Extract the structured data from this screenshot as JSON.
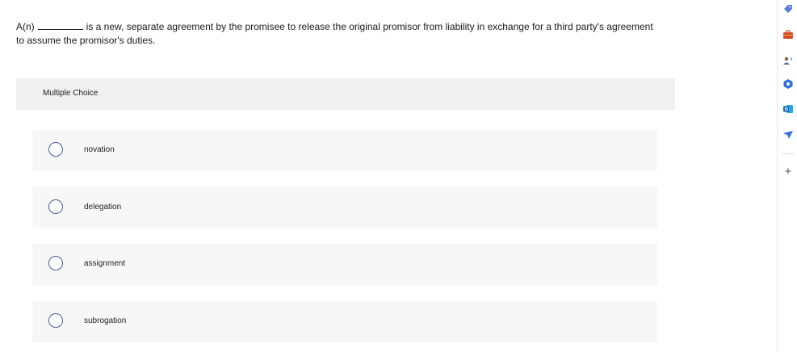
{
  "question": {
    "prefix": "A(n)",
    "text_line1": "is a new, separate agreement by the promisee to release the original promisor from liability in exchange for a third party's agreement",
    "text_line2": "to assume the promisor's duties."
  },
  "multiple_choice": {
    "title": "Multiple Choice",
    "options": [
      {
        "label": "novation"
      },
      {
        "label": "delegation"
      },
      {
        "label": "assignment"
      },
      {
        "label": "subrogation"
      }
    ]
  },
  "sidebar": {
    "icons": [
      "tag-icon",
      "briefcase-icon",
      "people-icon",
      "gem-icon",
      "outlook-icon",
      "send-icon"
    ],
    "add_label": "+"
  },
  "colors": {
    "radio_border": "#4a5f99",
    "panel_bg": "#f5f5f5",
    "option_bg": "#f7f7f7"
  }
}
